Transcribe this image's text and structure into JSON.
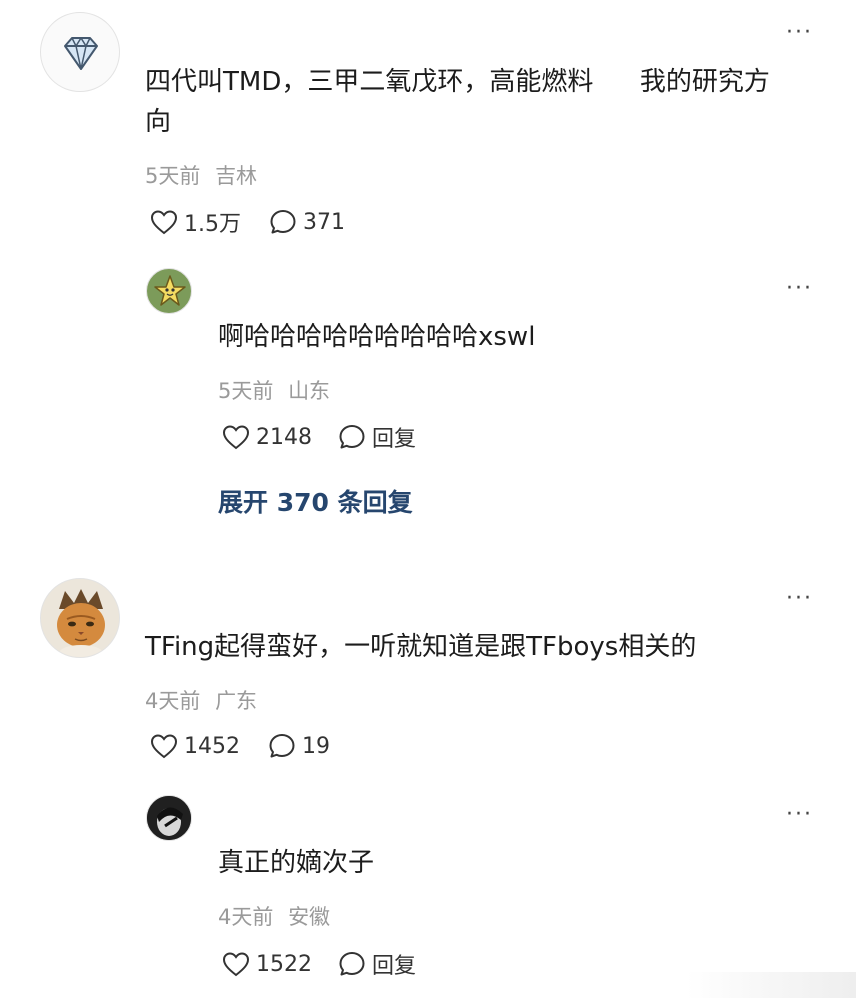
{
  "comments": [
    {
      "text_line1": "四代叫TMD，三甲二氧戊环，高能燃料",
      "text_line1b": "我的研究方",
      "text_line2": "向",
      "time": "5天前",
      "location": "吉林",
      "likes": "1.5万",
      "replies_count": "371",
      "reply": {
        "text": "啊哈哈哈哈哈哈哈哈哈xswl",
        "time": "5天前",
        "location": "山东",
        "likes": "2148",
        "reply_label": "回复"
      },
      "expand_label": "展开 370 条回复"
    },
    {
      "text": "TFing起得蛮好，一听就知道是跟TFboys相关的",
      "time": "4天前",
      "location": "广东",
      "likes": "1452",
      "replies_count": "19",
      "reply": {
        "text": "真正的嫡次子",
        "time": "4天前",
        "location": "安徽",
        "likes": "1522",
        "reply_label": "回复"
      }
    }
  ],
  "more_label": "···",
  "icons": [
    "diamond-icon",
    "heart-icon",
    "comment-icon",
    "more-icon"
  ],
  "colors": {
    "link": "#26466e",
    "meta": "#9a9a9a",
    "text": "#1c1c1c"
  }
}
